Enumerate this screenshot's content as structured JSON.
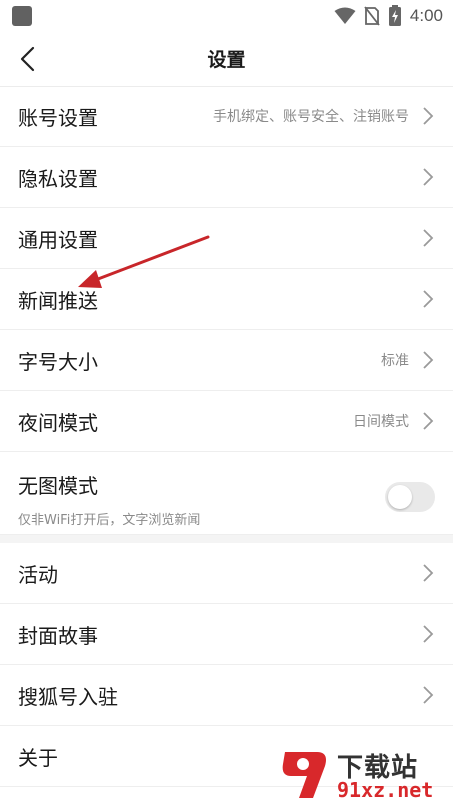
{
  "status_bar": {
    "time": "4:00",
    "icons": [
      "app-square-icon",
      "wifi-icon",
      "no-sim-icon",
      "battery-charging-icon"
    ]
  },
  "header": {
    "title": "设置",
    "back_icon": "chevron-left-icon"
  },
  "settings": [
    {
      "label": "账号设置",
      "value": "手机绑定、账号安全、注销账号"
    },
    {
      "label": "隐私设置",
      "value": ""
    },
    {
      "label": "通用设置",
      "value": ""
    },
    {
      "label": "新闻推送",
      "value": ""
    },
    {
      "label": "字号大小",
      "value": "标准"
    },
    {
      "label": "夜间模式",
      "value": "日间模式"
    }
  ],
  "no_image_mode": {
    "label": "无图模式",
    "subtitle": "仅非WiFi打开后，文字浏览新闻",
    "enabled": false
  },
  "more_items": [
    {
      "label": "活动"
    },
    {
      "label": "封面故事"
    },
    {
      "label": "搜狐号入驻"
    },
    {
      "label": "关于"
    }
  ],
  "annotation": {
    "color": "#c8262a"
  },
  "watermark": {
    "line1": "下载站",
    "line2": "91xz.net"
  },
  "colors": {
    "accent_red": "#d8282b",
    "secondary_text": "#8a8a8a"
  }
}
